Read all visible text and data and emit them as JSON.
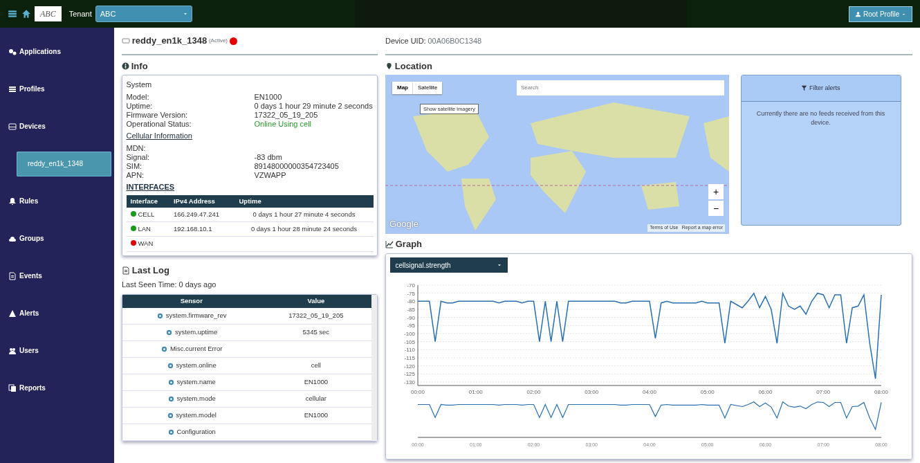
{
  "topbar": {
    "logo": "ABC",
    "tenant_label": "Tenant",
    "tenant_value": "ABC",
    "profile_button": "Root Profile"
  },
  "sidebar": {
    "items": [
      {
        "label": "Applications",
        "selected": false,
        "kind": "main"
      },
      {
        "label": "Profiles",
        "selected": false,
        "kind": "main"
      },
      {
        "label": "Devices",
        "selected": false,
        "kind": "main"
      },
      {
        "label": "reddy_en1k_1348",
        "selected": true,
        "kind": "sub"
      },
      {
        "label": "Rules",
        "selected": false,
        "kind": "main"
      },
      {
        "label": "Groups",
        "selected": false,
        "kind": "main"
      },
      {
        "label": "Events",
        "selected": false,
        "kind": "main"
      },
      {
        "label": "Alerts",
        "selected": false,
        "kind": "main"
      },
      {
        "label": "Users",
        "selected": false,
        "kind": "main"
      },
      {
        "label": "Reports",
        "selected": false,
        "kind": "main"
      }
    ]
  },
  "device": {
    "name": "reddy_en1k_1348",
    "state": "(Active)",
    "connected": false,
    "uid_label": "Device UID:",
    "uid": "00A06B0C1348"
  },
  "info": {
    "title": "Info",
    "system_title": "System",
    "system": [
      {
        "label": "Model:",
        "value": "EN1000",
        "kind": "plain"
      },
      {
        "label": "Uptime:",
        "value": "0 days 1 hour 29 minute 2 seconds",
        "kind": "plain"
      },
      {
        "label": "Firmware Version:",
        "value": "17322_05_19_205",
        "kind": "plain"
      },
      {
        "label": "Operational Status:",
        "value": "Online Using cell",
        "kind": "good"
      }
    ],
    "cellular_title": "Cellular Information",
    "cellular": [
      {
        "label": "MDN:"
      },
      {
        "label": "Signal:",
        "value": "-83 dbm"
      },
      {
        "label": "SIM:",
        "value": "89148000000354723405"
      },
      {
        "label": "APN:",
        "value": "VZWAPP"
      }
    ],
    "interfaces_title": "INTERFACES",
    "interfaces": {
      "columns": [
        "Interface",
        "IPv4 Address",
        "Uptime"
      ],
      "rows": [
        {
          "name": "CELL",
          "color": "#1a9a1a",
          "ip": "166.249.47.241",
          "uptime": "0 days 1 hour 27 minute 4 seconds"
        },
        {
          "name": "LAN",
          "color": "#1a9a1a",
          "ip": "192.168.10.1",
          "uptime": "0 days 1 hour 28 minute 24 seconds"
        },
        {
          "name": "WAN",
          "color": "#e00000"
        }
      ]
    }
  },
  "last_log": {
    "title": "Last Log",
    "last_seen": "Last Seen Time: 0 days ago",
    "columns": [
      "Sensor",
      "Value"
    ],
    "rows": [
      {
        "sensor": "system.firmware_rev",
        "value": "17322_05_19_205"
      },
      {
        "sensor": "system.uptime",
        "value": "5345 sec"
      },
      {
        "sensor": "Misc.current Error"
      },
      {
        "sensor": "system.online",
        "value": "cell"
      },
      {
        "sensor": "system.name",
        "value": "EN1000"
      },
      {
        "sensor": "system.mode",
        "value": "cellular"
      },
      {
        "sensor": "system.model",
        "value": "EN1000"
      },
      {
        "sensor": "Configuration"
      }
    ]
  },
  "location": {
    "title": "Location",
    "map_buttons": [
      {
        "label": "Map",
        "selected": true
      },
      {
        "label": "Satellite",
        "selected": false
      }
    ],
    "tooltip": "Show satellite imagery",
    "search_placeholder": "Search",
    "zoom_in": "+",
    "zoom_out": "−",
    "brand": "Google",
    "footer": [
      "Terms of Use",
      "Report a map error"
    ]
  },
  "alerts": {
    "filter_button": "Filter alerts",
    "message": "Currently there are no feeds received from this device."
  },
  "graph": {
    "title": "Graph",
    "select": "cellsignal.strength",
    "chart_data": {
      "type": "line",
      "grid": true,
      "xlim": [
        0,
        8
      ],
      "ylim": [
        -130,
        -70
      ],
      "yticks": [
        -70,
        -75,
        -80,
        -85,
        -90,
        -95,
        -100,
        -105,
        -110,
        -115,
        -120,
        -125,
        -130
      ],
      "xticks": [
        {
          "value": 0,
          "label": "00:00"
        },
        {
          "value": 1,
          "label": "01:00"
        },
        {
          "value": 2,
          "label": "02:00"
        },
        {
          "value": 3,
          "label": "03:00"
        },
        {
          "value": 4,
          "label": "04:00"
        },
        {
          "value": 5,
          "label": "05:00"
        },
        {
          "value": 6,
          "label": "06:00"
        },
        {
          "value": 7,
          "label": "07:00"
        },
        {
          "value": 8,
          "label": "08:00"
        }
      ],
      "x": [
        0,
        0.1,
        0.2,
        0.3,
        0.4,
        0.5,
        0.6,
        0.7,
        0.8,
        0.9,
        1,
        1.1,
        1.2,
        1.3,
        1.4,
        1.5,
        1.6,
        1.7,
        1.8,
        1.9,
        2,
        2.1,
        2.2,
        2.3,
        2.4,
        2.5,
        2.6,
        2.7,
        2.8,
        2.9,
        3,
        3.1,
        3.2,
        3.3,
        3.4,
        3.5,
        3.6,
        3.7,
        3.8,
        3.9,
        4,
        4.1,
        4.2,
        4.3,
        4.4,
        4.5,
        4.6,
        4.7,
        4.8,
        4.9,
        5,
        5.1,
        5.2,
        5.3,
        5.4,
        5.5,
        5.6,
        5.7,
        5.8,
        5.9,
        6,
        6.1,
        6.2,
        6.3,
        6.4,
        6.5,
        6.6,
        6.7,
        6.8,
        6.9,
        7,
        7.1,
        7.2,
        7.3,
        7.4,
        7.5,
        7.6,
        7.7,
        7.8,
        7.9,
        8
      ],
      "series": [
        {
          "color": "#2a6fb0",
          "values": [
            -80,
            -80,
            -80,
            -105,
            -80,
            -81,
            -81,
            -80,
            -80,
            -80,
            -80,
            -80,
            -80,
            -80,
            -81,
            -80,
            -80,
            -80,
            -81,
            -80,
            -80,
            -105,
            -80,
            -105,
            -80,
            -105,
            -80,
            -80,
            -80,
            -80,
            -80,
            -80,
            -80,
            -80,
            -80,
            -81,
            -81,
            -80,
            -80,
            -80,
            -80,
            -103,
            -81,
            -80,
            -81,
            -81,
            -81,
            -81,
            -81,
            -80,
            -81,
            -81,
            -81,
            -106,
            -80,
            -82,
            -84,
            -80,
            -75,
            -84,
            -77,
            -85,
            -106,
            -75,
            -83,
            -85,
            -83,
            -88,
            -80,
            -75,
            -76,
            -84,
            -76,
            -76,
            -106,
            -84,
            -83,
            -76,
            -106,
            -128,
            -76
          ]
        }
      ]
    },
    "navigator_ticks": [
      "00:00",
      "01:00",
      "02:00",
      "03:00",
      "04:00",
      "05:00",
      "06:00",
      "07:00",
      "08:00"
    ]
  }
}
